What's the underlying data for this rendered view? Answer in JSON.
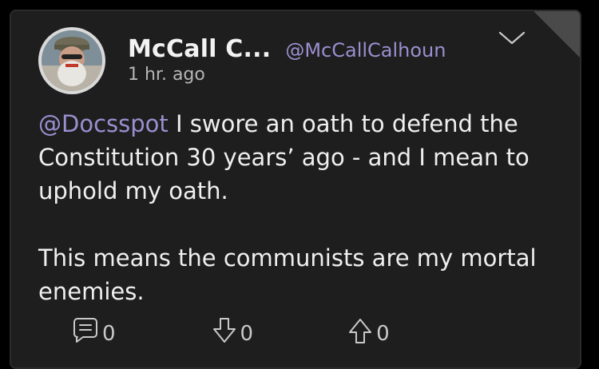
{
  "post": {
    "author": {
      "display_name": "McCall C...",
      "handle": "@McCallCalhoun"
    },
    "timestamp": "1 hr. ago",
    "body": {
      "mention": "@Docsspot",
      "line1_rest": " I swore an oath to defend the Constitution 30 years’ ago - and I mean to uphold my oath.",
      "paragraph2": "This means the communists are my mortal enemies."
    },
    "actions": {
      "comments": "0",
      "downvotes": "0",
      "upvotes": "0"
    }
  },
  "colors": {
    "background": "#000000",
    "card": "#1e1e1e",
    "accent_link": "#9b8fd0",
    "text": "#efefef",
    "muted": "#b5b5b5"
  }
}
